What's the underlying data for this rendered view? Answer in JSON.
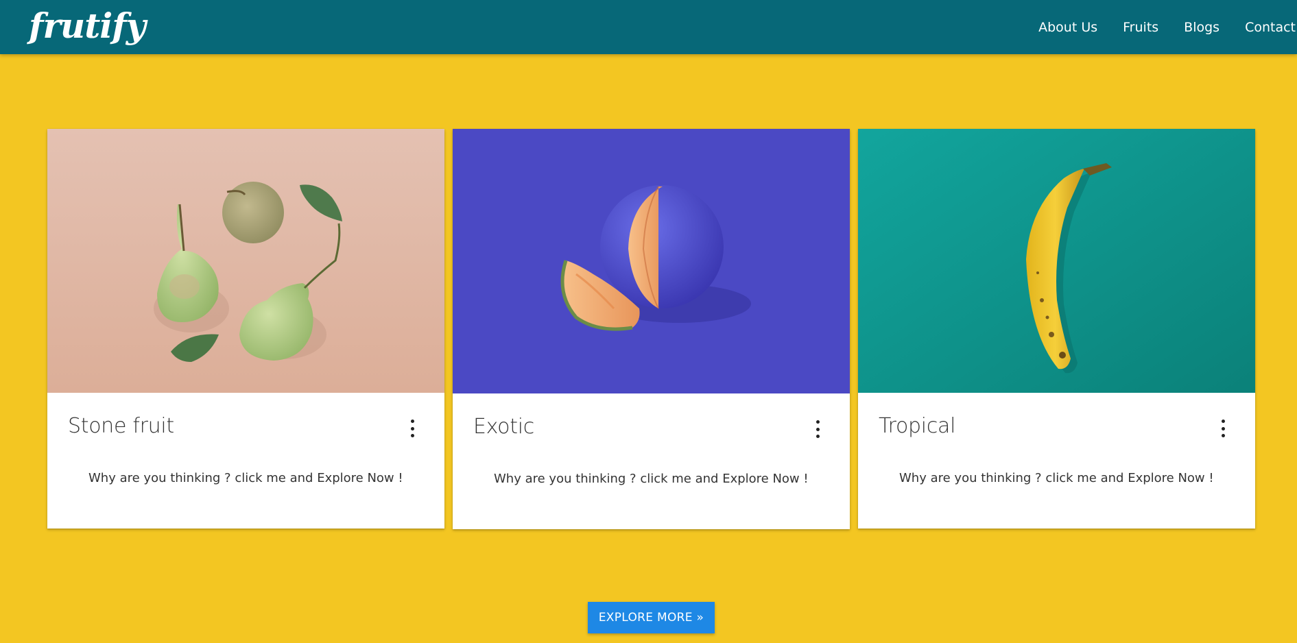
{
  "brand": {
    "name": "frutify"
  },
  "nav": {
    "items": [
      {
        "label": "About Us"
      },
      {
        "label": "Fruits"
      },
      {
        "label": "Blogs"
      },
      {
        "label": "Contact"
      }
    ]
  },
  "cards": [
    {
      "title": "Stone fruit",
      "text": "Why are you thinking ? click me and Explore Now !",
      "image": "pears-photo",
      "bg_color": "#e2b9a6"
    },
    {
      "title": "Exotic",
      "text": "Why are you thinking ? click me and Explore Now !",
      "image": "melon-photo",
      "bg_color": "#4b49c4"
    },
    {
      "title": "Tropical",
      "text": "Why are you thinking ? click me and Explore Now !",
      "image": "banana-photo",
      "bg_color": "#0e958e"
    }
  ],
  "explore_button": {
    "label": "EXPLORE MORE »"
  },
  "colors": {
    "page_bg": "#f3c622",
    "navbar_bg": "#076878",
    "button_bg": "#1e88e5"
  }
}
